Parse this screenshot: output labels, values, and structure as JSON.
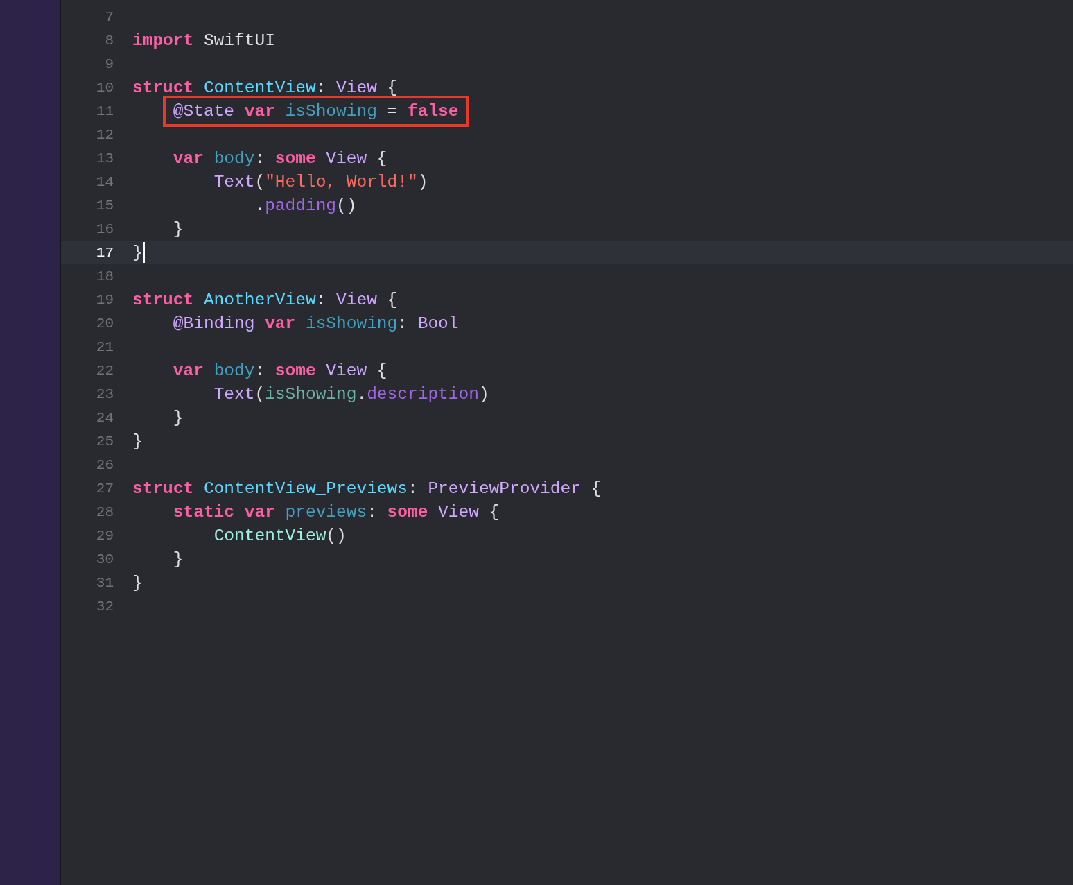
{
  "editor": {
    "lines": [
      {
        "number": "7"
      },
      {
        "number": "8",
        "tokens": [
          {
            "text": "import",
            "kind": "keyword"
          },
          {
            "text": " SwiftUI",
            "kind": "plain"
          }
        ]
      },
      {
        "number": "9"
      },
      {
        "number": "10",
        "tokens": [
          {
            "text": "struct ",
            "kind": "keyword"
          },
          {
            "text": "ContentView",
            "kind": "decl"
          },
          {
            "text": ": ",
            "kind": "plain"
          },
          {
            "text": "View",
            "kind": "type"
          },
          {
            "text": " {",
            "kind": "plain"
          }
        ]
      },
      {
        "number": "11",
        "boxed": true,
        "tokens": [
          {
            "text": "    @State ",
            "kind": "type"
          },
          {
            "text": "var ",
            "kind": "keyword"
          },
          {
            "text": "isShowing",
            "kind": "prop"
          },
          {
            "text": " = ",
            "kind": "plain"
          },
          {
            "text": "false",
            "kind": "keyword"
          }
        ]
      },
      {
        "number": "12"
      },
      {
        "number": "13",
        "tokens": [
          {
            "text": "    var ",
            "kind": "keyword"
          },
          {
            "text": "body",
            "kind": "prop"
          },
          {
            "text": ": ",
            "kind": "plain"
          },
          {
            "text": "some ",
            "kind": "keyword"
          },
          {
            "text": "View",
            "kind": "type"
          },
          {
            "text": " {",
            "kind": "plain"
          }
        ]
      },
      {
        "number": "14",
        "tokens": [
          {
            "text": "        Text",
            "kind": "type"
          },
          {
            "text": "(",
            "kind": "plain"
          },
          {
            "text": "\"Hello, World!\"",
            "kind": "string"
          },
          {
            "text": ")",
            "kind": "plain"
          }
        ]
      },
      {
        "number": "15",
        "tokens": [
          {
            "text": "            .",
            "kind": "plain"
          },
          {
            "text": "padding",
            "kind": "method"
          },
          {
            "text": "()",
            "kind": "plain"
          }
        ]
      },
      {
        "number": "16",
        "tokens": [
          {
            "text": "    }",
            "kind": "plain"
          }
        ]
      },
      {
        "number": "17",
        "current": true,
        "tokens": [
          {
            "text": "}",
            "kind": "plain"
          }
        ]
      },
      {
        "number": "18"
      },
      {
        "number": "19",
        "tokens": [
          {
            "text": "struct ",
            "kind": "keyword"
          },
          {
            "text": "AnotherView",
            "kind": "decl"
          },
          {
            "text": ": ",
            "kind": "plain"
          },
          {
            "text": "View",
            "kind": "type"
          },
          {
            "text": " {",
            "kind": "plain"
          }
        ]
      },
      {
        "number": "20",
        "tokens": [
          {
            "text": "    @Binding ",
            "kind": "type"
          },
          {
            "text": "var ",
            "kind": "keyword"
          },
          {
            "text": "isShowing",
            "kind": "prop"
          },
          {
            "text": ": ",
            "kind": "plain"
          },
          {
            "text": "Bool",
            "kind": "type"
          }
        ]
      },
      {
        "number": "21"
      },
      {
        "number": "22",
        "tokens": [
          {
            "text": "    var ",
            "kind": "keyword"
          },
          {
            "text": "body",
            "kind": "prop"
          },
          {
            "text": ": ",
            "kind": "plain"
          },
          {
            "text": "some ",
            "kind": "keyword"
          },
          {
            "text": "View",
            "kind": "type"
          },
          {
            "text": " {",
            "kind": "plain"
          }
        ]
      },
      {
        "number": "23",
        "tokens": [
          {
            "text": "        Text",
            "kind": "type"
          },
          {
            "text": "(",
            "kind": "plain"
          },
          {
            "text": "isShowing",
            "kind": "ref"
          },
          {
            "text": ".",
            "kind": "plain"
          },
          {
            "text": "description",
            "kind": "method"
          },
          {
            "text": ")",
            "kind": "plain"
          }
        ]
      },
      {
        "number": "24",
        "tokens": [
          {
            "text": "    }",
            "kind": "plain"
          }
        ]
      },
      {
        "number": "25",
        "tokens": [
          {
            "text": "}",
            "kind": "plain"
          }
        ]
      },
      {
        "number": "26"
      },
      {
        "number": "27",
        "tokens": [
          {
            "text": "struct ",
            "kind": "keyword"
          },
          {
            "text": "ContentView_Previews",
            "kind": "decl"
          },
          {
            "text": ": ",
            "kind": "plain"
          },
          {
            "text": "PreviewProvider",
            "kind": "type"
          },
          {
            "text": " {",
            "kind": "plain"
          }
        ]
      },
      {
        "number": "28",
        "tokens": [
          {
            "text": "    static var ",
            "kind": "keyword"
          },
          {
            "text": "previews",
            "kind": "prop"
          },
          {
            "text": ": ",
            "kind": "plain"
          },
          {
            "text": "some ",
            "kind": "keyword"
          },
          {
            "text": "View",
            "kind": "type"
          },
          {
            "text": " {",
            "kind": "plain"
          }
        ]
      },
      {
        "number": "29",
        "tokens": [
          {
            "text": "        ContentView",
            "kind": "call"
          },
          {
            "text": "()",
            "kind": "plain"
          }
        ]
      },
      {
        "number": "30",
        "tokens": [
          {
            "text": "    }",
            "kind": "plain"
          }
        ]
      },
      {
        "number": "31",
        "tokens": [
          {
            "text": "}",
            "kind": "plain"
          }
        ]
      },
      {
        "number": "32"
      }
    ]
  }
}
